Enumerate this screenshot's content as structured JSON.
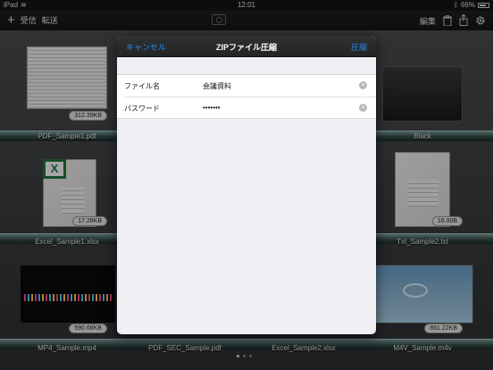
{
  "status_bar": {
    "device": "iPad",
    "time": "12:01",
    "battery": "66%"
  },
  "toolbar": {
    "add_icon": "plus-icon",
    "receive_label": "受信",
    "transfer_label": "転送",
    "edit_label": "編集",
    "trash_icon": "trash-icon",
    "share_icon": "share-icon",
    "settings_icon": "gear-icon"
  },
  "files": [
    {
      "name": "PDF_Sample1.pdf",
      "size": "312.39KB",
      "kind": "pdf"
    },
    {
      "name": "Black",
      "size": "",
      "kind": "folder"
    },
    {
      "name": "Excel_Sample1.xlsx",
      "size": "17.28KB",
      "kind": "excel"
    },
    {
      "name": "Txt_Sample2.txt",
      "size": "16.00B",
      "kind": "text"
    },
    {
      "name": "MP4_Sample.mp4",
      "size": "590.66KB",
      "kind": "video"
    },
    {
      "name": "PDF_SEC_Sample.pdf",
      "size": "",
      "kind": "pdf"
    },
    {
      "name": "Excel_Sample2.xlsx",
      "size": "",
      "kind": "excel"
    },
    {
      "name": "M4V_Sample.m4v",
      "size": "861.22KB",
      "kind": "video"
    }
  ],
  "dialog": {
    "title": "ZIPファイル圧縮",
    "cancel_label": "キャンセル",
    "compress_label": "圧縮",
    "filename_label": "ファイル名",
    "filename_value": "会議資料",
    "password_label": "パスワード",
    "password_value": "•••••••"
  },
  "accent_color": "#2a8cf0"
}
